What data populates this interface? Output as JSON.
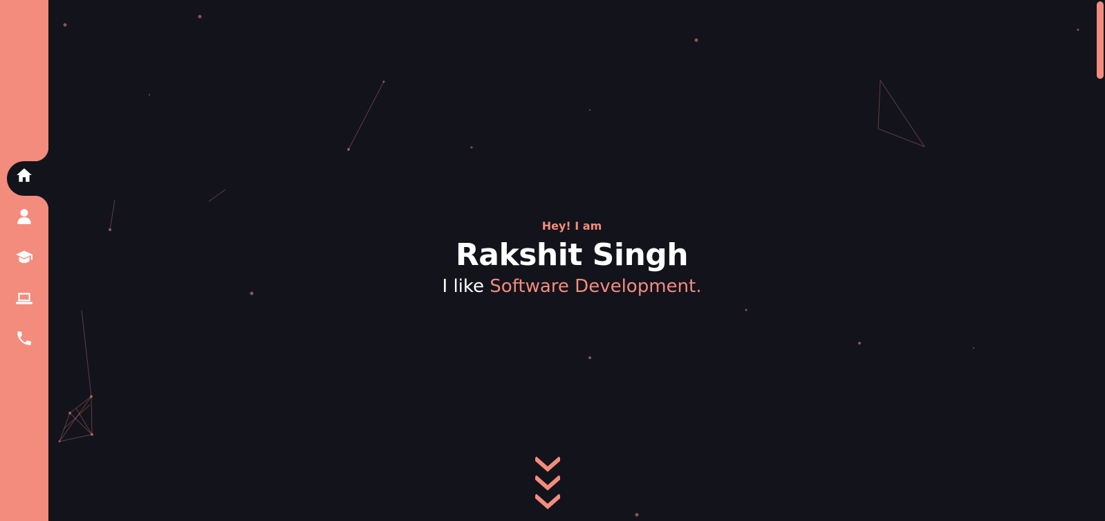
{
  "nav": {
    "items": [
      {
        "icon": "home-icon",
        "active": true
      },
      {
        "icon": "user-icon",
        "active": false
      },
      {
        "icon": "graduation-cap-icon",
        "active": false
      },
      {
        "icon": "laptop-icon",
        "active": false
      },
      {
        "icon": "phone-icon",
        "active": false
      }
    ]
  },
  "hero": {
    "eyebrow": "Hey! I am",
    "name": "Rakshit Singh",
    "tagline_prefix": "I like ",
    "tagline_accent": "Software Development."
  },
  "scroll_hint": {
    "icon": "chevron-down-icon",
    "count": 3
  },
  "colors": {
    "background": "#13131c",
    "accent": "#f38c7d",
    "text": "#ffffff"
  }
}
